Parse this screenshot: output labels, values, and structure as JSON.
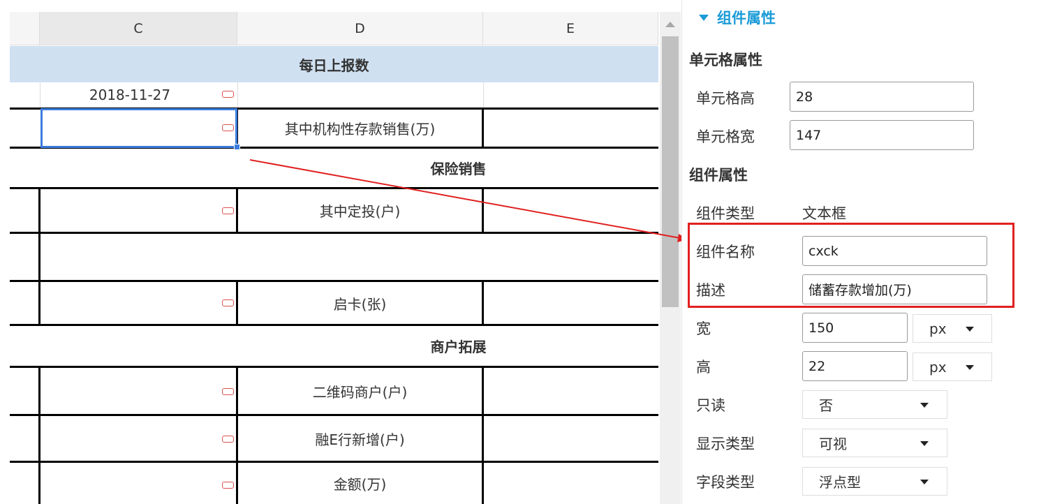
{
  "sheet": {
    "columns": [
      "C",
      "D",
      "E"
    ],
    "sections": {
      "daily": "每日上报数",
      "insurance": "保险销售",
      "merchant": "商户拓展"
    },
    "date_value": "2018-11-27",
    "row_labels": {
      "institutional": "其中机构性存款销售(万)",
      "fixed_invest": "其中定投(户)",
      "card_open": "启卡(张)",
      "qrcode": "二维码商户(户)",
      "rongeh": "融E行新增(户)",
      "amount": "金额(万)"
    }
  },
  "panel": {
    "title": "组件属性",
    "cell_section": "单元格属性",
    "cell_height_label": "单元格高",
    "cell_height": "28",
    "cell_width_label": "单元格宽",
    "cell_width": "147",
    "comp_section": "组件属性",
    "type_label": "组件类型",
    "type_value": "文本框",
    "name_label": "组件名称",
    "name_value": "cxck",
    "desc_label": "描述",
    "desc_value": "储蓄存款增加(万)",
    "width_label": "宽",
    "width_value": "150",
    "width_unit": "px",
    "height_label": "高",
    "height_value": "22",
    "height_unit": "px",
    "readonly_label": "只读",
    "readonly_value": "否",
    "display_label": "显示类型",
    "display_value": "可视",
    "field_label": "字段类型",
    "field_value": "浮点型"
  },
  "colors": {
    "section_header_bg": "#cfe0f1",
    "accent": "#1a9bd7",
    "selection": "#3b7ddd",
    "highlight_box": "#e02020",
    "marker": "#d9534f"
  }
}
